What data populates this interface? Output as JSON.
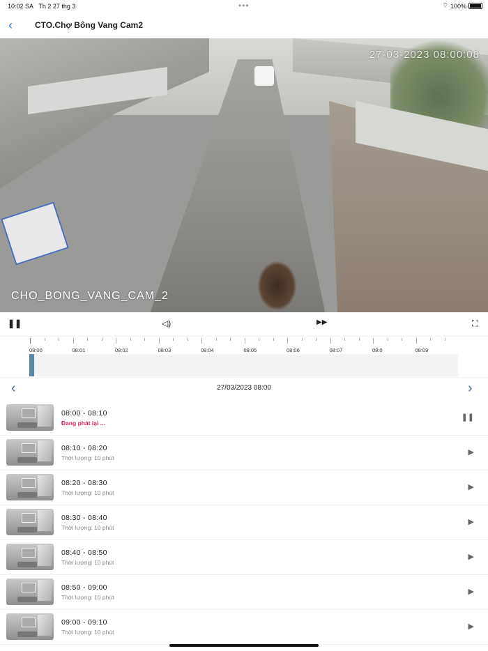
{
  "status_bar": {
    "time": "10:02 SA",
    "date": "Th 2 27 thg 3",
    "battery": "100%"
  },
  "header": {
    "back_icon": "chevron-left-icon",
    "title": "CTO.Chợ Bông Vang Cam2"
  },
  "video": {
    "timestamp": "27-03-2023 08:00:08",
    "camera_label": "CHO_BONG_VANG_CAM_2"
  },
  "controls": {
    "pause": "⏸",
    "volume": "🔈",
    "fast_forward": "⏩",
    "fullscreen": "⛶"
  },
  "timeline": {
    "labels": [
      "08:00",
      "08:01",
      "08:02",
      "08:03",
      "08:04",
      "08:05",
      "08:06",
      "08:07",
      "08:0",
      "08:09"
    ],
    "progress_percent": 1,
    "accent": "#5b87ab"
  },
  "date_nav": {
    "date": "27/03/2023 08:00",
    "prev": "‹",
    "next": "›"
  },
  "recordings": [
    {
      "range": "08:00 - 08:10",
      "subtitle": "Đang phát lại ...",
      "state": "playing"
    },
    {
      "range": "08:10 - 08:20",
      "subtitle": "Thời lượng: 10 phút",
      "state": "idle"
    },
    {
      "range": "08:20 - 08:30",
      "subtitle": "Thời lượng: 10 phút",
      "state": "idle"
    },
    {
      "range": "08:30 - 08:40",
      "subtitle": "Thời lượng: 10 phút",
      "state": "idle"
    },
    {
      "range": "08:40 - 08:50",
      "subtitle": "Thời lượng: 10 phút",
      "state": "idle"
    },
    {
      "range": "08:50 - 09:00",
      "subtitle": "Thời lượng: 10 phút",
      "state": "idle"
    },
    {
      "range": "09:00 - 09:10",
      "subtitle": "Thời lượng: 10 phút",
      "state": "idle"
    }
  ]
}
